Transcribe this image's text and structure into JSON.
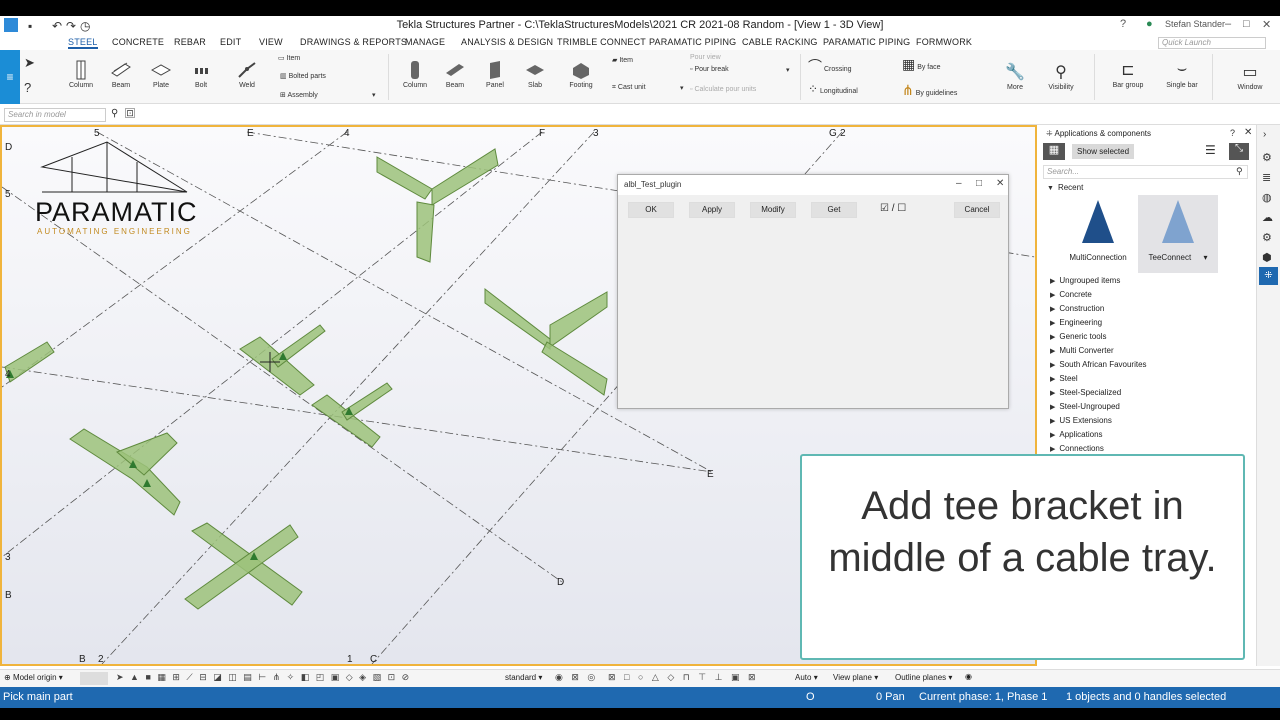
{
  "app": {
    "title": "Tekla Structures Partner - C:\\TeklaStructuresModels\\2021 CR 2021-08 Random  - [View 1 - 3D View]",
    "user": "Stefan Stander"
  },
  "menu": {
    "tabs": [
      "STEEL",
      "CONCRETE",
      "REBAR",
      "EDIT",
      "VIEW",
      "DRAWINGS & REPORTS",
      "MANAGE",
      "ANALYSIS & DESIGN",
      "TRIMBLE CONNECT",
      "PARAMATIC PIPING",
      "CABLE RACKING",
      "PARAMATIC PIPING",
      "FORMWORK"
    ],
    "quick_launch_placeholder": "Quick Launch"
  },
  "ribbon": {
    "steel": [
      "Column",
      "Beam",
      "Plate",
      "Bolt",
      "Weld"
    ],
    "steel_small": [
      "Item",
      "Bolted parts",
      "Assembly"
    ],
    "concrete": [
      "Column",
      "Beam",
      "Panel",
      "Slab",
      "Footing"
    ],
    "concrete_small": [
      "Item",
      "Cast unit"
    ],
    "pour": [
      "Pour view",
      "Pour break",
      "Calculate pour units"
    ],
    "rebar_small": [
      "Crossing",
      "Longitudinal",
      "By face",
      "By guidelines"
    ],
    "right": [
      "More",
      "Visibility",
      "Bar group",
      "Single bar",
      "Window"
    ]
  },
  "search": {
    "placeholder": "Search in model"
  },
  "view": {
    "grid_labels": [
      "D",
      "5",
      "E",
      "4",
      "F",
      "3",
      "G",
      "2",
      "5",
      "3",
      "B",
      "B",
      "2",
      "1",
      "C",
      "D",
      "E",
      "4"
    ],
    "logo_text": "PARAMATIC",
    "logo_subtitle": "AUTOMATING ENGINEERING"
  },
  "dialog": {
    "title": "albl_Test_plugin",
    "buttons": [
      "OK",
      "Apply",
      "Modify",
      "Get",
      "Cancel"
    ],
    "toggle": "☑ / ☐"
  },
  "panel": {
    "title": "Applications & components",
    "show_selected": "Show selected",
    "search_placeholder": "Search...",
    "recent_label": "Recent",
    "tiles": [
      "MultiConnection",
      "TeeConnect"
    ],
    "categories": [
      "Ungrouped items",
      "Concrete",
      "Construction",
      "Engineering",
      "Generic tools",
      "Multi Converter",
      "South African Favourites",
      "Steel",
      "Steel-Specialized",
      "Steel-Ungrouped",
      "US Extensions",
      "Applications",
      "Connections"
    ]
  },
  "caption": {
    "text": "Add tee bracket in middle of a cable tray."
  },
  "bottom_toolbar": {
    "model_origin": "Model origin",
    "standard": "standard",
    "auto": "Auto",
    "view_plane": "View plane",
    "outline_planes": "Outline planes"
  },
  "status": {
    "prompt": "Pick main part",
    "o": "O",
    "pan": "0  Pan",
    "phase": "Current phase: 1, Phase 1",
    "selection": "1 objects and 0 handles selected"
  },
  "colors": {
    "accent": "#1f69b0",
    "tray_fill": "#9cc27a",
    "tray_stroke": "#5f8a3e",
    "view_border": "#f0b43c",
    "caption_border": "#5fb8b3"
  }
}
